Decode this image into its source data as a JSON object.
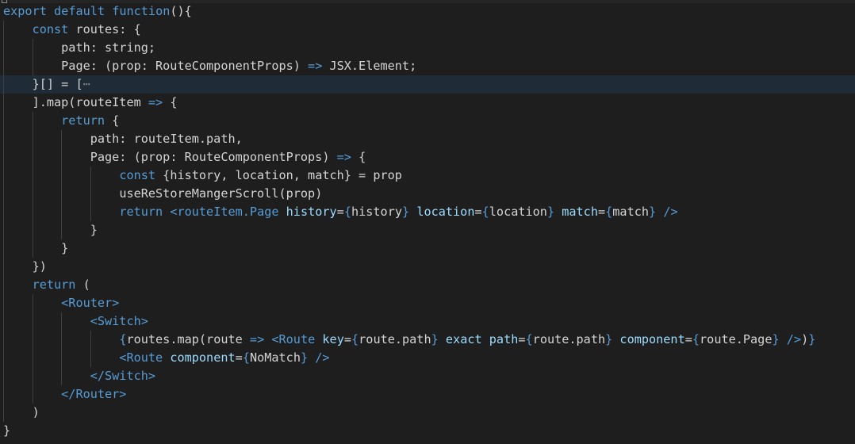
{
  "editor": {
    "lines": [
      {
        "indent": 0,
        "active": false,
        "tokens": [
          {
            "c": "kw",
            "t": "export"
          },
          {
            "c": "plain",
            "t": " "
          },
          {
            "c": "kw",
            "t": "default"
          },
          {
            "c": "plain",
            "t": " "
          },
          {
            "c": "kw",
            "t": "function"
          },
          {
            "c": "plain",
            "t": "(){"
          }
        ]
      },
      {
        "indent": 1,
        "active": false,
        "tokens": [
          {
            "c": "kw",
            "t": "const"
          },
          {
            "c": "plain",
            "t": " routes: {"
          }
        ]
      },
      {
        "indent": 2,
        "active": false,
        "tokens": [
          {
            "c": "plain",
            "t": "path: string;"
          }
        ]
      },
      {
        "indent": 2,
        "active": false,
        "tokens": [
          {
            "c": "plain",
            "t": "Page: (prop: RouteComponentProps) "
          },
          {
            "c": "arrow",
            "t": "=>"
          },
          {
            "c": "plain",
            "t": " JSX.Element;"
          }
        ]
      },
      {
        "indent": 1,
        "active": true,
        "tokens": [
          {
            "c": "plain",
            "t": "}[] = ["
          },
          {
            "c": "ellipsis",
            "t": "⋯"
          }
        ]
      },
      {
        "indent": 1,
        "active": false,
        "tokens": [
          {
            "c": "plain",
            "t": "].map(routeItem "
          },
          {
            "c": "arrow",
            "t": "=>"
          },
          {
            "c": "plain",
            "t": " {"
          }
        ]
      },
      {
        "indent": 2,
        "active": false,
        "tokens": [
          {
            "c": "kw",
            "t": "return"
          },
          {
            "c": "plain",
            "t": " {"
          }
        ]
      },
      {
        "indent": 3,
        "active": false,
        "tokens": [
          {
            "c": "plain",
            "t": "path: routeItem.path,"
          }
        ]
      },
      {
        "indent": 3,
        "active": false,
        "tokens": [
          {
            "c": "plain",
            "t": "Page: (prop: RouteComponentProps) "
          },
          {
            "c": "arrow",
            "t": "=>"
          },
          {
            "c": "plain",
            "t": " {"
          }
        ]
      },
      {
        "indent": 4,
        "active": false,
        "tokens": [
          {
            "c": "kw",
            "t": "const"
          },
          {
            "c": "plain",
            "t": " {history, location, match} = prop"
          }
        ]
      },
      {
        "indent": 4,
        "active": false,
        "tokens": [
          {
            "c": "plain",
            "t": "useReStoreMangerScroll(prop)"
          }
        ]
      },
      {
        "indent": 4,
        "active": false,
        "tokens": [
          {
            "c": "kw",
            "t": "return"
          },
          {
            "c": "plain",
            "t": " "
          },
          {
            "c": "tag",
            "t": "<routeItem.Page"
          },
          {
            "c": "plain",
            "t": " "
          },
          {
            "c": "attr",
            "t": "history"
          },
          {
            "c": "plain",
            "t": "="
          },
          {
            "c": "jsxbr",
            "t": "{"
          },
          {
            "c": "plain",
            "t": "history"
          },
          {
            "c": "jsxbr",
            "t": "}"
          },
          {
            "c": "plain",
            "t": " "
          },
          {
            "c": "attr",
            "t": "location"
          },
          {
            "c": "plain",
            "t": "="
          },
          {
            "c": "jsxbr",
            "t": "{"
          },
          {
            "c": "plain",
            "t": "location"
          },
          {
            "c": "jsxbr",
            "t": "}"
          },
          {
            "c": "plain",
            "t": " "
          },
          {
            "c": "attr",
            "t": "match"
          },
          {
            "c": "plain",
            "t": "="
          },
          {
            "c": "jsxbr",
            "t": "{"
          },
          {
            "c": "plain",
            "t": "match"
          },
          {
            "c": "jsxbr",
            "t": "}"
          },
          {
            "c": "plain",
            "t": " "
          },
          {
            "c": "tag",
            "t": "/>"
          }
        ]
      },
      {
        "indent": 3,
        "active": false,
        "tokens": [
          {
            "c": "plain",
            "t": "}"
          }
        ]
      },
      {
        "indent": 2,
        "active": false,
        "tokens": [
          {
            "c": "plain",
            "t": "}"
          }
        ]
      },
      {
        "indent": 1,
        "active": false,
        "tokens": [
          {
            "c": "plain",
            "t": "})"
          }
        ]
      },
      {
        "indent": 1,
        "active": false,
        "tokens": [
          {
            "c": "kw",
            "t": "return"
          },
          {
            "c": "plain",
            "t": " ("
          }
        ]
      },
      {
        "indent": 2,
        "active": false,
        "tokens": [
          {
            "c": "tag",
            "t": "<Router>"
          }
        ]
      },
      {
        "indent": 3,
        "active": false,
        "tokens": [
          {
            "c": "tag",
            "t": "<Switch>"
          }
        ]
      },
      {
        "indent": 4,
        "active": false,
        "tokens": [
          {
            "c": "jsxbr",
            "t": "{"
          },
          {
            "c": "plain",
            "t": "routes.map(route "
          },
          {
            "c": "arrow",
            "t": "=>"
          },
          {
            "c": "plain",
            "t": " "
          },
          {
            "c": "tag",
            "t": "<Route"
          },
          {
            "c": "plain",
            "t": " "
          },
          {
            "c": "attr",
            "t": "key"
          },
          {
            "c": "plain",
            "t": "="
          },
          {
            "c": "jsxbr",
            "t": "{"
          },
          {
            "c": "plain",
            "t": "route.path"
          },
          {
            "c": "jsxbr",
            "t": "}"
          },
          {
            "c": "plain",
            "t": " "
          },
          {
            "c": "attr",
            "t": "exact"
          },
          {
            "c": "plain",
            "t": " "
          },
          {
            "c": "attr",
            "t": "path"
          },
          {
            "c": "plain",
            "t": "="
          },
          {
            "c": "jsxbr",
            "t": "{"
          },
          {
            "c": "plain",
            "t": "route.path"
          },
          {
            "c": "jsxbr",
            "t": "}"
          },
          {
            "c": "plain",
            "t": " "
          },
          {
            "c": "attr",
            "t": "component"
          },
          {
            "c": "plain",
            "t": "="
          },
          {
            "c": "jsxbr",
            "t": "{"
          },
          {
            "c": "plain",
            "t": "route.Page"
          },
          {
            "c": "jsxbr",
            "t": "}"
          },
          {
            "c": "plain",
            "t": " "
          },
          {
            "c": "tag",
            "t": "/>"
          },
          {
            "c": "plain",
            "t": ")"
          },
          {
            "c": "jsxbr",
            "t": "}"
          }
        ]
      },
      {
        "indent": 4,
        "active": false,
        "tokens": [
          {
            "c": "tag",
            "t": "<Route"
          },
          {
            "c": "plain",
            "t": " "
          },
          {
            "c": "attr",
            "t": "component"
          },
          {
            "c": "plain",
            "t": "="
          },
          {
            "c": "jsxbr",
            "t": "{"
          },
          {
            "c": "plain",
            "t": "NoMatch"
          },
          {
            "c": "jsxbr",
            "t": "}"
          },
          {
            "c": "plain",
            "t": " "
          },
          {
            "c": "tag",
            "t": "/>"
          }
        ]
      },
      {
        "indent": 3,
        "active": false,
        "tokens": [
          {
            "c": "tag",
            "t": "</Switch>"
          }
        ]
      },
      {
        "indent": 2,
        "active": false,
        "tokens": [
          {
            "c": "tag",
            "t": "</Router>"
          }
        ]
      },
      {
        "indent": 1,
        "active": false,
        "tokens": [
          {
            "c": "plain",
            "t": ")"
          }
        ]
      },
      {
        "indent": 0,
        "active": false,
        "tokens": [
          {
            "c": "plain",
            "t": "}"
          }
        ]
      }
    ]
  }
}
